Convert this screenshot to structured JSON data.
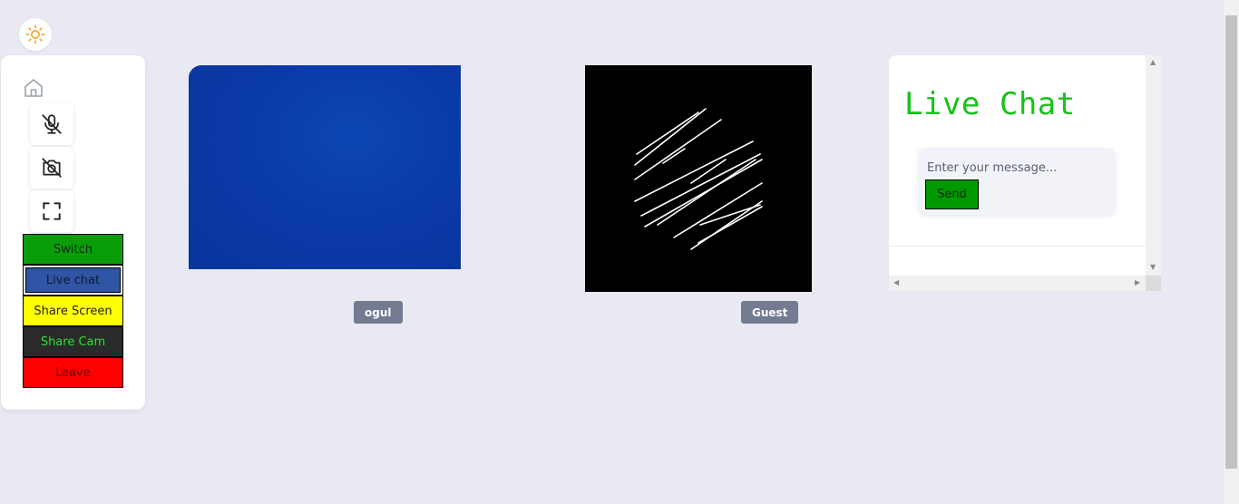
{
  "theme_toggle": {
    "icon": "sun-icon",
    "color": "#f4a62a"
  },
  "sidebar": {
    "home_icon": "home-icon",
    "tools": [
      {
        "name": "mic-off",
        "icon": "mic-off-icon"
      },
      {
        "name": "camera-off",
        "icon": "camera-off-icon"
      },
      {
        "name": "fullscreen",
        "icon": "fullscreen-icon"
      }
    ],
    "buttons": {
      "switch": "Switch",
      "live_chat": "Live chat",
      "share_screen": "Share Screen",
      "share_cam": "Share Cam",
      "leave": "Leave"
    }
  },
  "videos": {
    "local_name": "ogul",
    "remote_name": "Guest"
  },
  "chat": {
    "title": "Live Chat",
    "input_placeholder": "Enter your message...",
    "send_label": "Send"
  },
  "colors": {
    "background": "#e9e9f3",
    "switch": "#0a9d0a",
    "live_chat": "#2f55a4",
    "share_screen": "#ffff00",
    "share_cam": "#2a2a2a",
    "leave": "#ff0000",
    "chat_title": "#17c21a",
    "send": "#009900"
  }
}
